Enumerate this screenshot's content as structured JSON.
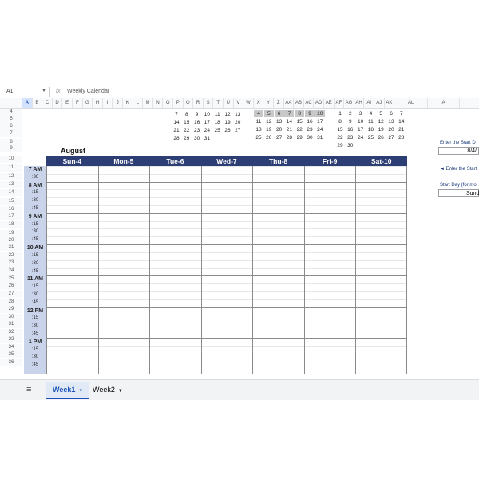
{
  "formula_bar": {
    "name_box": "A1",
    "formula": "Weekly Calendar"
  },
  "columns": [
    "A",
    "B",
    "C",
    "D",
    "E",
    "F",
    "G",
    "H",
    "I",
    "J",
    "K",
    "L",
    "M",
    "N",
    "O",
    "P",
    "Q",
    "R",
    "S",
    "T",
    "U",
    "V",
    "W",
    "X",
    "Y",
    "Z",
    "AA",
    "AB",
    "AC",
    "AD",
    "AE",
    "AF",
    "AG",
    "AH",
    "AI",
    "AJ",
    "AK",
    "AL",
    "A"
  ],
  "rows": [
    "4",
    "5",
    "6",
    "7",
    "8",
    "9",
    "10",
    "11",
    "12",
    "13",
    "14",
    "15",
    "16",
    "17",
    "18",
    "19",
    "20",
    "21",
    "22",
    "23",
    "24",
    "25",
    "26",
    "27",
    "28",
    "29",
    "30",
    "31",
    "32",
    "33",
    "34",
    "35",
    "36"
  ],
  "mini_calendars": [
    {
      "rows": [
        [
          "",
          "",
          "",
          "",
          "",
          "",
          ""
        ],
        [
          "7",
          "8",
          "9",
          "10",
          "11",
          "12",
          "13"
        ],
        [
          "14",
          "15",
          "16",
          "17",
          "18",
          "19",
          "20"
        ],
        [
          "21",
          "22",
          "23",
          "24",
          "25",
          "26",
          "27"
        ],
        [
          "28",
          "29",
          "30",
          "31",
          "",
          "",
          ""
        ]
      ]
    },
    {
      "rows": [
        [
          "4",
          "5",
          "6",
          "7",
          "8",
          "9",
          "10"
        ],
        [
          "11",
          "12",
          "13",
          "14",
          "15",
          "16",
          "17"
        ],
        [
          "18",
          "19",
          "20",
          "21",
          "22",
          "23",
          "24"
        ],
        [
          "25",
          "26",
          "27",
          "28",
          "29",
          "30",
          "31"
        ]
      ]
    },
    {
      "rows": [
        [
          "1",
          "2",
          "3",
          "4",
          "5",
          "6",
          "7"
        ],
        [
          "8",
          "9",
          "10",
          "11",
          "12",
          "13",
          "14"
        ],
        [
          "15",
          "16",
          "17",
          "18",
          "19",
          "20",
          "21"
        ],
        [
          "22",
          "23",
          "24",
          "25",
          "26",
          "27",
          "28"
        ],
        [
          "29",
          "30",
          "",
          "",
          "",
          "",
          ""
        ]
      ]
    }
  ],
  "calendar": {
    "month": "August",
    "days": [
      "Sun-4",
      "Mon-5",
      "Tue-6",
      "Wed-7",
      "Thu-8",
      "Fri-9",
      "Sat-10"
    ],
    "times": [
      "7 AM",
      ":30",
      "8 AM",
      ":15",
      ":30",
      ":45",
      "9 AM",
      ":15",
      ":30",
      ":45",
      "10 AM",
      ":15",
      ":30",
      ":45",
      "11 AM",
      ":15",
      ":30",
      ":45",
      "12 PM",
      ":15",
      ":30",
      ":45",
      "1 PM",
      ":15",
      ":30",
      ":45"
    ]
  },
  "side_panel": {
    "start_date_label": "Enter the Start D",
    "start_date_value": "8/4/",
    "arrow_hint": "◄ Enter the Start",
    "start_day_label": "Start Day (for mo",
    "start_day_value": "Sund"
  },
  "sheet_tabs": [
    {
      "label": "Week1",
      "active": true
    },
    {
      "label": "Week2",
      "active": false
    }
  ],
  "colors": {
    "header_bg": "#2c3e73",
    "time_bg": "#c9d3ea",
    "highlight": "#c8c8c8",
    "accent": "#1a53b5"
  }
}
